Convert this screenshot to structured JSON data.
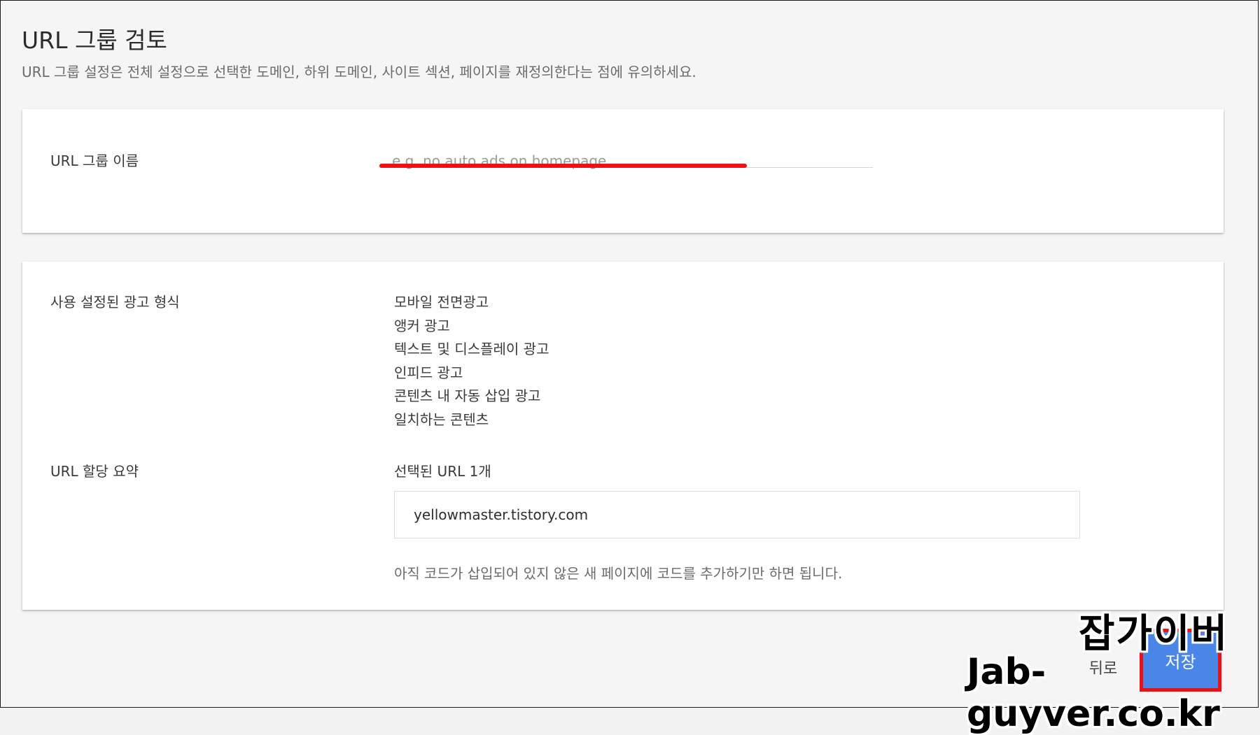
{
  "header": {
    "title": "URL 그룹 검토",
    "subtitle": "URL 그룹 설정은 전체 설정으로 선택한 도메인, 하위 도메인, 사이트 섹션, 페이지를 재정의한다는 점에 유의하세요."
  },
  "name_section": {
    "label": "URL 그룹 이름",
    "input_value": "",
    "input_placeholder": "e.g. no auto ads on homepage"
  },
  "formats_section": {
    "label": "사용 설정된 광고 형식",
    "items": [
      "모바일 전면광고",
      "앵커 광고",
      "텍스트 및 디스플레이 광고",
      "인피드 광고",
      "콘텐츠 내 자동 삽입 광고",
      "일치하는 콘텐츠"
    ]
  },
  "summary_section": {
    "label": "URL 할당 요약",
    "count_text": "선택된 URL 1개",
    "urls": [
      "yellowmaster.tistory.com"
    ],
    "note": "아직 코드가 삽입되어 있지 않은 새 페이지에 코드를 추가하기만 하면 됩니다."
  },
  "actions": {
    "back_label": "뒤로",
    "save_label": "저장"
  },
  "watermark": {
    "korean": "잡가이버",
    "domain": "Jab-guyver.co.kr"
  },
  "colors": {
    "primary_button": "#4a86e8",
    "highlight_red": "#ee1111",
    "background": "#f5f5f5"
  }
}
